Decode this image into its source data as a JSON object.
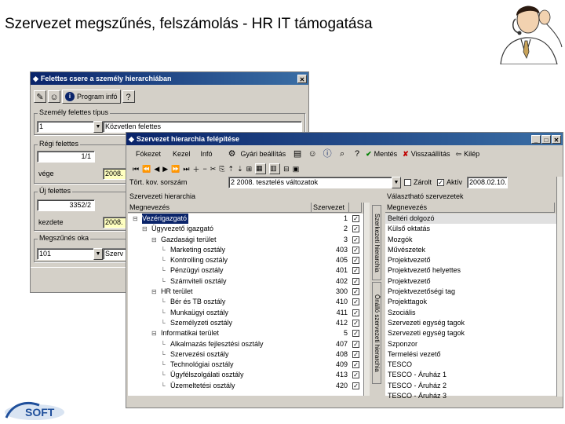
{
  "slide": {
    "title": "Szervezet megszűnés, felszámolás - HR IT támogatása"
  },
  "colors": {
    "titlebar": "#0a246a",
    "selection": "#0a246a",
    "panel": "#d4d0c8",
    "yellow_field": "#ffffc0"
  },
  "win1": {
    "title": "Felettes csere a személy hierarchiában",
    "program_info": "Program infó",
    "group_type": {
      "label": "Személy felettes típus",
      "code": "1",
      "value": "Közvetlen felettes"
    },
    "group_old": {
      "label": "Régi felettes",
      "value": "1/1",
      "end_label": "vége",
      "end_value": "2008."
    },
    "group_new": {
      "label": "Új felettes",
      "value": "3352/2",
      "start_label": "kezdete",
      "start_value": "2008."
    },
    "group_reason": {
      "label": "Megszűnés oka",
      "code": "101",
      "value": "Szerv"
    }
  },
  "win2": {
    "title": "Szervezet hierarchia felépítése",
    "menu": [
      "Fókezet",
      "Kezel",
      "Infó"
    ],
    "toolbar": {
      "factory_settings": "Gyári beállítás",
      "save": "Mentés",
      "undo": "Visszaállítás",
      "exit": "Kilép",
      "closed": "Zárolt",
      "active": "Aktív",
      "active_date": "2008.02.10."
    },
    "org_bar": {
      "label": "Tört. kov. sorszám",
      "value": "2 2008. tesztelés változatok"
    },
    "left": {
      "section": "Szervezeti hierarchia",
      "col_name": "Megnevezés",
      "col_code": "Szervezet",
      "rows": [
        {
          "name": "Vezérigazgató",
          "code": "1",
          "level": 0,
          "selected": true
        },
        {
          "name": "Ügyvezető igazgató",
          "code": "2",
          "level": 1
        },
        {
          "name": "Gazdasági terület",
          "code": "3",
          "level": 2
        },
        {
          "name": "Marketing osztály",
          "code": "403",
          "level": 3
        },
        {
          "name": "Kontrolling osztály",
          "code": "405",
          "level": 3
        },
        {
          "name": "Pénzügyi osztály",
          "code": "401",
          "level": 3
        },
        {
          "name": "Számviteli osztály",
          "code": "402",
          "level": 3
        },
        {
          "name": "HR terület",
          "code": "300",
          "level": 2
        },
        {
          "name": "Bér és TB osztály",
          "code": "410",
          "level": 3
        },
        {
          "name": "Munkaügyi osztály",
          "code": "411",
          "level": 3
        },
        {
          "name": "Személyzeti osztály",
          "code": "412",
          "level": 3
        },
        {
          "name": "Informatikai terület",
          "code": "5",
          "level": 2
        },
        {
          "name": "Alkalmazás fejlesztési osztály",
          "code": "407",
          "level": 3
        },
        {
          "name": "Szervezési osztály",
          "code": "408",
          "level": 3
        },
        {
          "name": "Technológiai osztály",
          "code": "409",
          "level": 3
        },
        {
          "name": "Ügyfélszolgálati osztály",
          "code": "413",
          "level": 3
        },
        {
          "name": "Üzemeltetési osztály",
          "code": "420",
          "level": 3
        }
      ]
    },
    "vtabs": {
      "left": "Szerkezeti hierarchia",
      "right": "Önálló szervezeti hierarchia"
    },
    "right": {
      "section": "Választható szervezetek",
      "col_name": "Megnevezés",
      "rows": [
        "Beltéri dolgozó",
        "Külső oktatás",
        "Mozgók",
        "Művészetek",
        "Projektvezető",
        "Projektvezető helyettes",
        "Projektvezető",
        "Projektvezetőségi tag",
        "Projekttagok",
        "Szociális",
        "Szervezeti egység tagok",
        "Szervezeti egység tagok",
        "Szponzor",
        "Termelési vezető",
        "TESCO",
        "TESCO - Áruház 1",
        "TESCO - Áruház 2",
        "TESCO - Áruház 3"
      ]
    }
  }
}
